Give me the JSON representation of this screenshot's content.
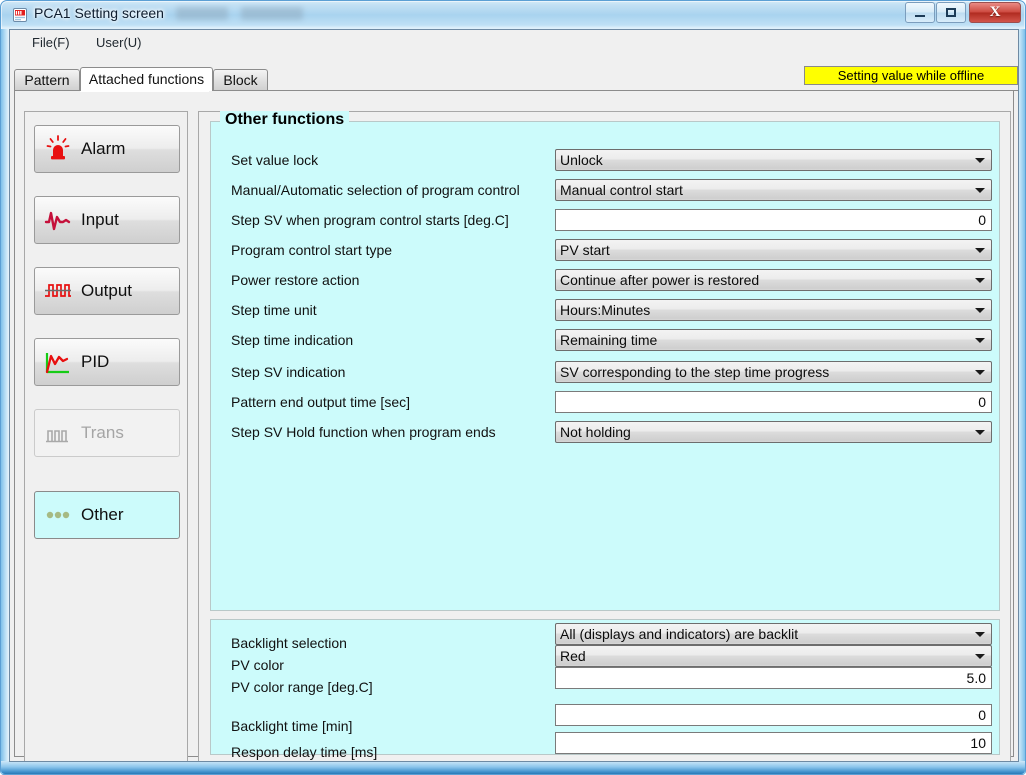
{
  "window": {
    "title": "PCA1 Setting screen",
    "icon": "app-icon",
    "controls": {
      "minimize": "minimize",
      "maximize": "maximize",
      "close": "X"
    }
  },
  "menubar": {
    "items": [
      {
        "label": "File(F)",
        "name": "menu-file"
      },
      {
        "label": "User(U)",
        "name": "menu-user"
      }
    ]
  },
  "status": {
    "offline_banner": "Setting value while offline",
    "offline_banner_bg": "#ffff00"
  },
  "tabs": [
    {
      "label": "Pattern",
      "active": false
    },
    {
      "label": "Attached functions",
      "active": true
    },
    {
      "label": "Block",
      "active": false
    }
  ],
  "sidebar": {
    "items": [
      {
        "label": "Alarm",
        "icon": "alarm-beacon-icon",
        "state": "enabled"
      },
      {
        "label": "Input",
        "icon": "waveform-icon",
        "state": "enabled"
      },
      {
        "label": "Output",
        "icon": "square-wave-icon",
        "state": "enabled"
      },
      {
        "label": "PID",
        "icon": "pid-curve-icon",
        "state": "enabled"
      },
      {
        "label": "Trans",
        "icon": "bars-icon",
        "state": "disabled"
      },
      {
        "label": "Other",
        "icon": "three-dots-icon",
        "state": "selected"
      }
    ]
  },
  "main": {
    "group_title": "Other functions",
    "fields": [
      {
        "label": "Set value lock",
        "type": "combo",
        "value": "Unlock"
      },
      {
        "label": "Manual/Automatic selection of program control",
        "type": "combo",
        "value": "Manual control start"
      },
      {
        "label": "Step SV when program control starts [deg.C]",
        "type": "text",
        "value": "0"
      },
      {
        "label": "Program control start type",
        "type": "combo",
        "value": "PV start"
      },
      {
        "label": "Power restore action",
        "type": "combo",
        "value": "Continue after power is restored"
      },
      {
        "label": "Step time unit",
        "type": "combo",
        "value": "Hours:Minutes"
      },
      {
        "label": "Step time indication",
        "type": "combo",
        "value": "Remaining time"
      },
      {
        "label": "Step SV indication",
        "type": "combo",
        "value": "SV corresponding to the step time progress"
      },
      {
        "label": "Pattern end output time [sec]",
        "type": "text",
        "value": "0"
      },
      {
        "label": "Step SV Hold function when program ends",
        "type": "combo",
        "value": "Not holding"
      }
    ]
  },
  "backlight": {
    "fields": [
      {
        "label": "Backlight selection",
        "type": "combo",
        "value": "All (displays and indicators) are backlit"
      },
      {
        "label": "PV color",
        "type": "combo",
        "value": "Red"
      },
      {
        "label": "PV color range [deg.C]",
        "type": "text",
        "value": "5.0"
      },
      {
        "label": "Backlight time [min]",
        "type": "text",
        "value": "0"
      },
      {
        "label": "Respon delay time [ms]",
        "type": "text",
        "value": "10"
      }
    ]
  },
  "colors": {
    "panel_cyan": "#ccfbfb",
    "window_chrome": "#f0f0f0",
    "accent_blue": "#7ec0ea",
    "alert_yellow": "#ffff00",
    "icon_red": "#e81010",
    "icon_green": "#16cc16"
  }
}
